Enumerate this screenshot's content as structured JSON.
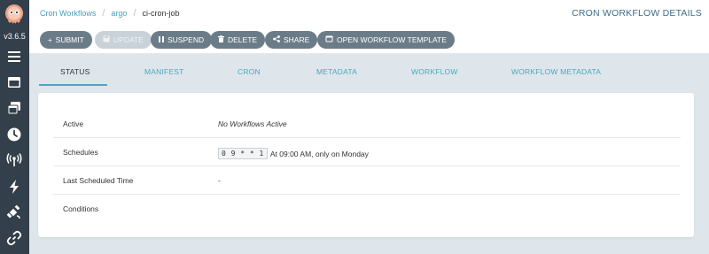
{
  "app": {
    "version": "v3.6.5"
  },
  "sidebar": {
    "items": [
      {
        "icon": "menu-icon",
        "active": false
      },
      {
        "icon": "workflows-icon",
        "active": false
      },
      {
        "icon": "workflow-templates-icon",
        "active": false
      },
      {
        "icon": "clock-icon",
        "active": true
      },
      {
        "icon": "antenna-icon",
        "active": false
      },
      {
        "icon": "bolt-icon",
        "active": false
      },
      {
        "icon": "satellite-icon",
        "active": false
      },
      {
        "icon": "link-icon",
        "active": false
      }
    ]
  },
  "breadcrumb": {
    "root": "Cron Workflows",
    "namespace": "argo",
    "current": "ci-cron-job"
  },
  "header": {
    "title": "CRON WORKFLOW DETAILS"
  },
  "toolbar": {
    "submit": "SUBMIT",
    "update": "UPDATE",
    "suspend": "SUSPEND",
    "delete": "DELETE",
    "share": "SHARE",
    "open_template": "OPEN WORKFLOW TEMPLATE"
  },
  "tabs": {
    "status": "STATUS",
    "manifest": "MANIFEST",
    "cron": "CRON",
    "metadata": "METADATA",
    "workflow": "WORKFLOW",
    "workflow_metadata": "WORKFLOW METADATA",
    "active": "status"
  },
  "status": {
    "active": {
      "label": "Active",
      "value": "No Workflows Active"
    },
    "schedules": {
      "label": "Schedules",
      "cron": "0 9 * * 1",
      "description": "At 09:00 AM, only on Monday"
    },
    "last_scheduled": {
      "label": "Last Scheduled Time",
      "value": "-"
    },
    "conditions": {
      "label": "Conditions",
      "value": ""
    }
  },
  "colors": {
    "sidebar": "#333f4a",
    "accent": "#4ba6c0",
    "button": "#6b7c89",
    "button_disabled": "#c9d2d9",
    "background": "#dee6eb"
  }
}
